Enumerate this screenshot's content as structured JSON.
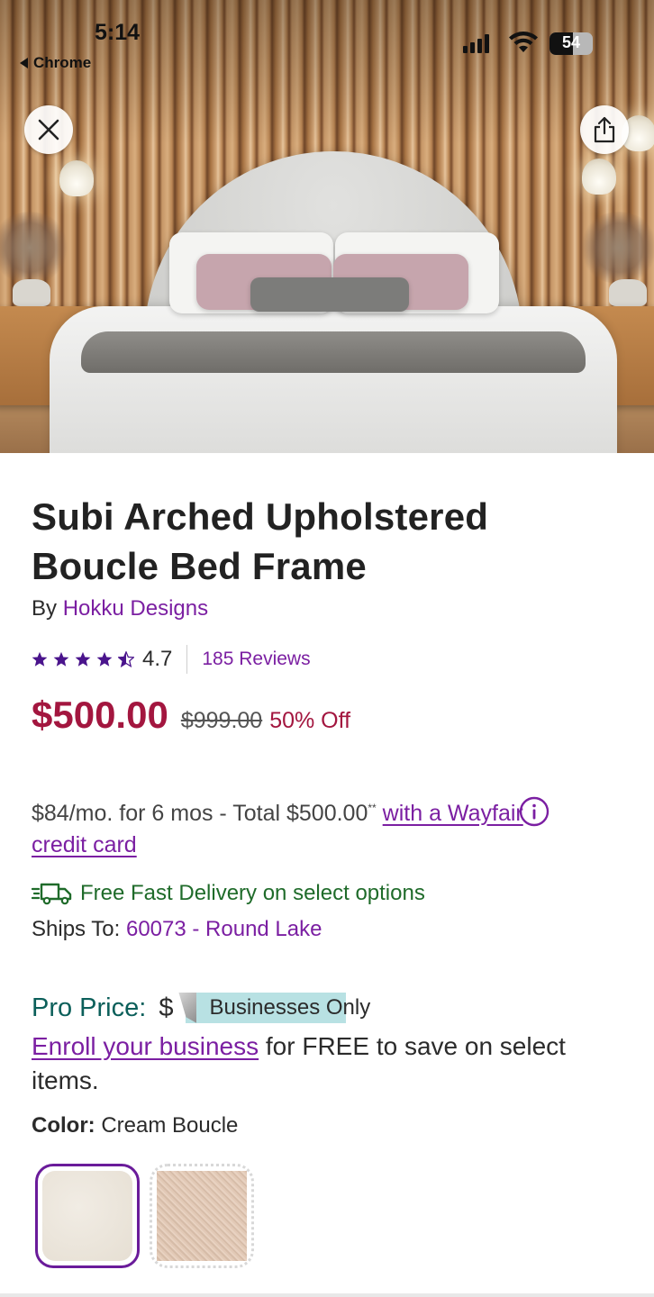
{
  "status_bar": {
    "time": "5:14",
    "back_app": "Chrome",
    "battery_level": "54"
  },
  "hero": {
    "image_alt": "Arched upholstered bed in bedroom with wood slat wall"
  },
  "buttons": {
    "close_icon": "close-icon",
    "share_icon": "share-icon"
  },
  "product": {
    "title": "Subi Arched Upholstered Boucle Bed Frame",
    "by_prefix": "By",
    "brand": "Hokku Designs",
    "rating_value": "4.7",
    "rating_stars": 4.5,
    "reviews": "185 Reviews",
    "price_now": "$500.00",
    "price_was": "$999.00",
    "price_off": "50% Off"
  },
  "financing": {
    "text": "$84/mo. for 6 mos - Total $500.00",
    "footnote_mark": "**",
    "link": "with a Wayfair credit card"
  },
  "delivery": {
    "text": "Free Fast Delivery on select options",
    "ships_label": "Ships To:",
    "ships_value": "60073 - Round Lake"
  },
  "pro": {
    "label": "Pro Price:",
    "dollar": "$",
    "tag": "Businesses Only",
    "enroll_link": "Enroll your business",
    "enroll_rest": " for FREE to save on select items."
  },
  "color": {
    "label": "Color:",
    "value": "Cream Boucle",
    "swatches": [
      {
        "name": "Cream Boucle",
        "selected": true
      },
      {
        "name": "Pink Boucle",
        "selected": false
      }
    ]
  },
  "colors": {
    "brand_purple": "#7b1fa2",
    "price_red": "#a3163f",
    "delivery_green": "#1f6b2a",
    "pro_teal": "#0b5f5a"
  }
}
